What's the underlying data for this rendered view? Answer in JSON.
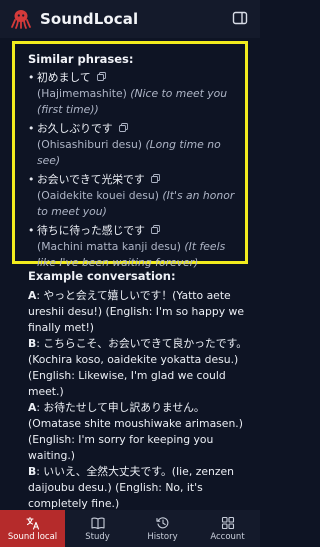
{
  "header": {
    "title": "SoundLocal",
    "logo_icon": "octopus-logo-icon",
    "sidebar_icon": "sidebar-toggle-icon"
  },
  "similar": {
    "title": "Similar phrases:",
    "items": [
      {
        "jp": "初めまして",
        "romaji": "(Hajimemashite)",
        "translation": "(Nice to meet you (first time))"
      },
      {
        "jp": "お久しぶりです",
        "romaji": "(Ohisashiburi desu)",
        "translation": "(Long time no see)"
      },
      {
        "jp": "お会いできて光栄です",
        "romaji": "(Oaidekite kouei desu)",
        "translation": "(It's an honor to meet you)"
      },
      {
        "jp": "待ちに待った感じです",
        "romaji": "(Machini matta kanji desu)",
        "translation": "(It feels like I've been waiting forever)"
      }
    ]
  },
  "conversation": {
    "title": "Example conversation:",
    "lines": [
      {
        "speaker": "A",
        "text": ": やっと会えて嬉しいです！(Yatto aete ureshii desu!) (English: I'm so happy we finally met!)"
      },
      {
        "speaker": "B",
        "text": ": こちらこそ、お会いできて良かったです。(Kochira koso, oaidekite yokatta desu.) (English: Likewise, I'm glad we could meet.)"
      },
      {
        "speaker": "A",
        "text": ": お待たせして申し訳ありません。(Omatase shite moushiwake arimasen.) (English: I'm sorry for keeping you waiting.)"
      },
      {
        "speaker": "B",
        "text": ": いいえ、全然大丈夫です。(Iie, zenzen daijoubu desu.) (English: No, it's completely fine.)"
      }
    ]
  },
  "nav": {
    "items": [
      {
        "label": "Sound local",
        "icon": "translate-icon",
        "active": true
      },
      {
        "label": "Study",
        "icon": "book-icon",
        "active": false
      },
      {
        "label": "History",
        "icon": "history-icon",
        "active": false
      },
      {
        "label": "Account",
        "icon": "grid-icon",
        "active": false
      }
    ]
  },
  "colors": {
    "accent": "#b52b2b",
    "highlight_border": "#f2ec1e",
    "background": "#0e1424"
  }
}
